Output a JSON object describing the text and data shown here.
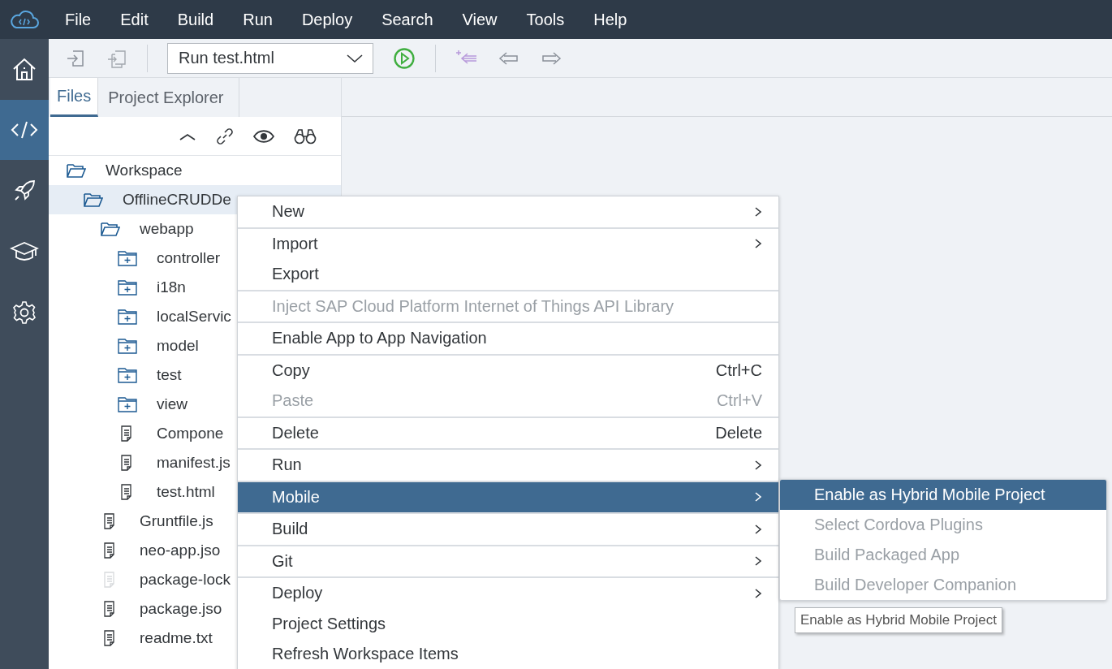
{
  "menubar": {
    "items": [
      {
        "label": "File"
      },
      {
        "label": "Edit"
      },
      {
        "label": "Build"
      },
      {
        "label": "Run"
      },
      {
        "label": "Deploy"
      },
      {
        "label": "Search"
      },
      {
        "label": "View"
      },
      {
        "label": "Tools"
      },
      {
        "label": "Help"
      }
    ]
  },
  "sidebar": {
    "items": [
      {
        "kind": "home",
        "selected": false
      },
      {
        "kind": "code",
        "selected": true
      },
      {
        "kind": "rocket",
        "selected": false
      },
      {
        "kind": "learn",
        "selected": false
      },
      {
        "kind": "settings",
        "selected": false
      }
    ]
  },
  "toolbar": {
    "run_config": "Run test.html"
  },
  "panel": {
    "tabs": [
      {
        "label": "Files",
        "selected": true
      },
      {
        "label": "Project Explorer",
        "selected": false
      }
    ],
    "tree": [
      {
        "label": "Workspace",
        "kind": "folder",
        "expanded": true,
        "selected": false,
        "children": [
          {
            "label": "OfflineCRUDDe",
            "kind": "folder",
            "expanded": true,
            "selected": true,
            "children": [
              {
                "label": "webapp",
                "kind": "folder",
                "expanded": true,
                "selected": false,
                "children": [
                  {
                    "label": "controller",
                    "kind": "folder",
                    "expanded": false,
                    "selected": false
                  },
                  {
                    "label": "i18n",
                    "kind": "folder",
                    "expanded": false,
                    "selected": false
                  },
                  {
                    "label": "localServic",
                    "kind": "folder",
                    "expanded": false,
                    "selected": false
                  },
                  {
                    "label": "model",
                    "kind": "folder",
                    "expanded": false,
                    "selected": false
                  },
                  {
                    "label": "test",
                    "kind": "folder",
                    "expanded": false,
                    "selected": false
                  },
                  {
                    "label": "view",
                    "kind": "folder",
                    "expanded": false,
                    "selected": false
                  },
                  {
                    "label": "Compone",
                    "kind": "file",
                    "selected": false,
                    "muted": false
                  },
                  {
                    "label": "manifest.js",
                    "kind": "file",
                    "selected": false,
                    "muted": false
                  },
                  {
                    "label": "test.html",
                    "kind": "file",
                    "selected": false,
                    "muted": false
                  }
                ]
              },
              {
                "label": "Gruntfile.js",
                "kind": "file",
                "selected": false,
                "muted": false
              },
              {
                "label": "neo-app.jso",
                "kind": "file",
                "selected": false,
                "muted": false
              },
              {
                "label": "package-lock",
                "kind": "file",
                "selected": false,
                "muted": true
              },
              {
                "label": "package.jso",
                "kind": "file",
                "selected": false,
                "muted": false
              },
              {
                "label": "readme.txt",
                "kind": "file",
                "selected": false,
                "muted": false
              }
            ]
          }
        ]
      }
    ]
  },
  "context_menu": {
    "groups": [
      [
        {
          "label": "New",
          "submenu": true,
          "disabled": false,
          "selected": false
        }
      ],
      [
        {
          "label": "Import",
          "submenu": true,
          "disabled": false,
          "selected": false
        },
        {
          "label": "Export",
          "submenu": false,
          "disabled": false,
          "selected": false
        }
      ],
      [
        {
          "label": "Inject SAP Cloud Platform Internet of Things API Library",
          "submenu": false,
          "disabled": true,
          "selected": false
        }
      ],
      [
        {
          "label": "Enable App to App Navigation",
          "submenu": false,
          "disabled": false,
          "selected": false
        }
      ],
      [
        {
          "label": "Copy",
          "shortcut": "Ctrl+C",
          "submenu": false,
          "disabled": false,
          "selected": false
        },
        {
          "label": "Paste",
          "shortcut": "Ctrl+V",
          "submenu": false,
          "disabled": true,
          "selected": false
        }
      ],
      [
        {
          "label": "Delete",
          "shortcut": "Delete",
          "submenu": false,
          "disabled": false,
          "selected": false
        }
      ],
      [
        {
          "label": "Run",
          "submenu": true,
          "disabled": false,
          "selected": false
        }
      ],
      [
        {
          "label": "Mobile",
          "submenu": true,
          "disabled": false,
          "selected": true
        }
      ],
      [
        {
          "label": "Build",
          "submenu": true,
          "disabled": false,
          "selected": false
        }
      ],
      [
        {
          "label": "Git",
          "submenu": true,
          "disabled": false,
          "selected": false
        }
      ],
      [
        {
          "label": "Deploy",
          "submenu": true,
          "disabled": false,
          "selected": false
        },
        {
          "label": "Project Settings",
          "submenu": false,
          "disabled": false,
          "selected": false
        },
        {
          "label": "Refresh Workspace Items",
          "submenu": false,
          "disabled": false,
          "selected": false
        }
      ]
    ]
  },
  "submenu": {
    "items": [
      {
        "label": "Enable as Hybrid Mobile Project",
        "disabled": false,
        "selected": true
      },
      {
        "label": "Select Cordova Plugins",
        "disabled": true,
        "selected": false
      },
      {
        "label": "Build Packaged App",
        "disabled": true,
        "selected": false
      },
      {
        "label": "Build Developer Companion",
        "disabled": true,
        "selected": false
      }
    ]
  },
  "tooltip": "Enable as Hybrid Mobile Project"
}
